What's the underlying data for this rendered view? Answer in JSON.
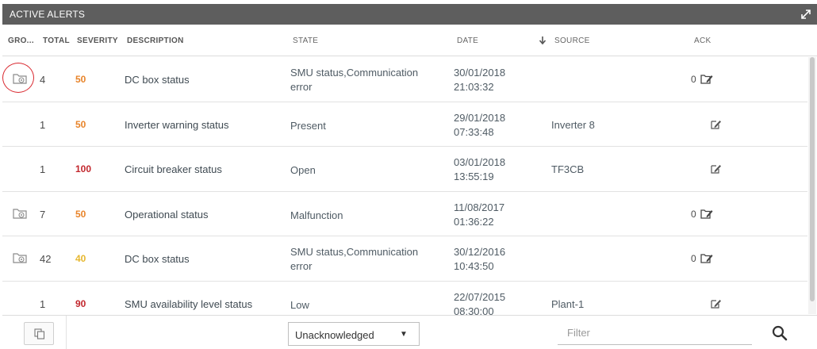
{
  "panel": {
    "title": "ACTIVE ALERTS",
    "expand_icon": "expand-icon"
  },
  "columns": {
    "group": "GRO...",
    "total": "TOTAL",
    "severity": "SEVERITY",
    "description": "DESCRIPTION",
    "state": "STATE",
    "date": "DATE",
    "source": "SOURCE",
    "ack": "ACK",
    "sort_icon": "sort-down-arrow-icon"
  },
  "colors": {
    "severity_orange": "#e8842a",
    "severity_red": "#c2272d",
    "severity_yellow": "#e6b72e",
    "highlight_circle": "#d9272e"
  },
  "rows": [
    {
      "has_group": true,
      "total": "4",
      "severity": "50",
      "severity_color": "orange",
      "description": "DC box status",
      "state_line1": "SMU status,Communication",
      "state_line2": "error",
      "date_line1": "30/01/2018",
      "date_line2": "21:03:32",
      "source": "",
      "ack_count": "0"
    },
    {
      "has_group": false,
      "total": "1",
      "severity": "50",
      "severity_color": "orange",
      "description": "Inverter warning status",
      "state_line1": "Present",
      "state_line2": "",
      "date_line1": "29/01/2018",
      "date_line2": "07:33:48",
      "source": "Inverter 8",
      "ack_count": ""
    },
    {
      "has_group": false,
      "total": "1",
      "severity": "100",
      "severity_color": "red",
      "description": "Circuit breaker status",
      "state_line1": "Open",
      "state_line2": "",
      "date_line1": "03/01/2018",
      "date_line2": "13:55:19",
      "source": "TF3CB",
      "ack_count": ""
    },
    {
      "has_group": true,
      "total": "7",
      "severity": "50",
      "severity_color": "orange",
      "description": "Operational status",
      "state_line1": "Malfunction",
      "state_line2": "",
      "date_line1": "11/08/2017",
      "date_line2": "01:36:22",
      "source": "",
      "ack_count": "0"
    },
    {
      "has_group": true,
      "total": "42",
      "severity": "40",
      "severity_color": "yellow",
      "description": "DC box status",
      "state_line1": "SMU status,Communication",
      "state_line2": "error",
      "date_line1": "30/12/2016",
      "date_line2": "10:43:50",
      "source": "",
      "ack_count": "0"
    },
    {
      "has_group": false,
      "total": "1",
      "severity": "90",
      "severity_color": "red",
      "description": "SMU availability level status",
      "state_line1": "Low",
      "state_line2": "",
      "date_line1": "22/07/2015",
      "date_line2": "08:30:00",
      "source": "Plant-1",
      "ack_count": ""
    }
  ],
  "footer": {
    "copy_icon": "copy-icon",
    "ack_filter_selected": "Unacknowledged",
    "filter_placeholder": "Filter",
    "search_icon": "search-icon"
  }
}
